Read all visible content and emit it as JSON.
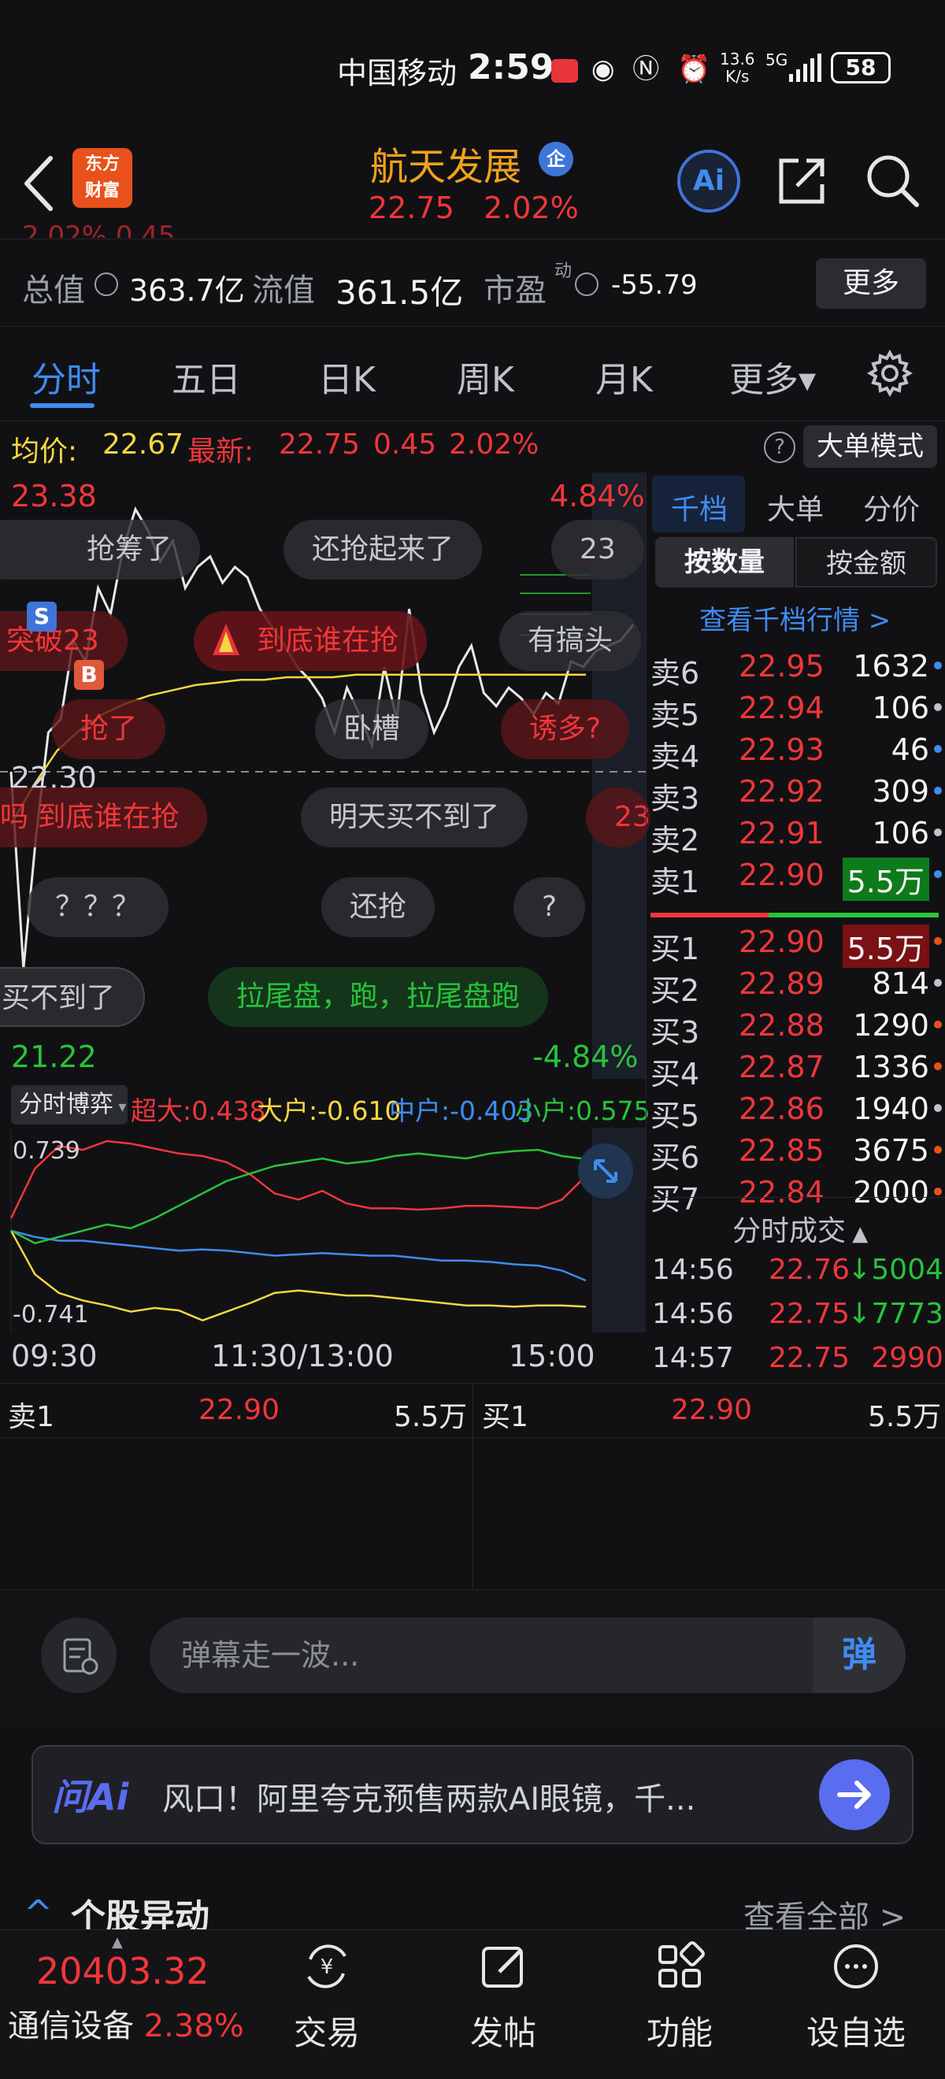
{
  "status_bar": {
    "carrier": "中国移动",
    "time": "2:59",
    "net_speed_top": "13.6",
    "net_speed_bottom": "K/s",
    "network": "5G",
    "battery": "58"
  },
  "header": {
    "logo_line1": "东方",
    "logo_line2": "财富",
    "stock_name": "航天发展",
    "ent_badge": "企",
    "price": "22.75",
    "change_pct": "2.02%",
    "ai_label": "Ai"
  },
  "metrics": {
    "cut_text": "2.02%    0.45",
    "total_value_label": "总值",
    "total_value": "363.7亿",
    "float_value_label": "流值",
    "float_value": "361.5亿",
    "pe_label": "市盈",
    "pe_sup": "动",
    "pe_value": "-55.79",
    "more_label": "更多"
  },
  "tabs": [
    "分时",
    "五日",
    "日K",
    "周K",
    "月K",
    "更多▾"
  ],
  "info_row": {
    "avg_label": "均价:",
    "avg_value": "22.67",
    "latest_label": "最新:",
    "latest_value": "22.75",
    "change": "0.45",
    "change_pct": "2.02%",
    "help": "?",
    "big_order_mode": "大单模式"
  },
  "chart_data": [
    {
      "type": "line",
      "title": "",
      "y_top_label": "23.38",
      "y_mid_label": "22.30",
      "y_bottom_label": "21.22",
      "pct_top_label": "4.84%",
      "pct_bottom_label": "-4.84%",
      "ylim": [
        21.22,
        23.38
      ],
      "x_labels": [
        "09:30",
        "11:30/13:00",
        "15:00"
      ],
      "series": [
        {
          "color": "#e8e8e8",
          "values": [
            22.3,
            21.55,
            22.05,
            22.45,
            22.5,
            22.8,
            22.72,
            23.0,
            22.9,
            23.15,
            23.3,
            23.22,
            23.1,
            23.18,
            23.0,
            23.08,
            23.12,
            23.02,
            23.08,
            23.04,
            22.92,
            22.85,
            22.78,
            22.7,
            22.65,
            22.58,
            22.45,
            22.62,
            22.52,
            22.4,
            22.7,
            22.5,
            22.92,
            22.6,
            22.45,
            22.55,
            22.7,
            22.78,
            22.6,
            22.55,
            22.62,
            22.58,
            22.52,
            22.6,
            22.56,
            22.72,
            22.7,
            22.76,
            22.78,
            22.8,
            22.86
          ]
        },
        {
          "color": "#f5d742",
          "values": [
            22.1,
            22.25,
            22.38,
            22.46,
            22.52,
            22.56,
            22.59,
            22.61,
            22.63,
            22.64,
            22.65,
            22.65,
            22.66,
            22.66,
            22.66,
            22.67,
            22.67,
            22.67,
            22.67,
            22.67,
            22.67,
            22.67,
            22.67,
            22.67,
            22.67,
            22.67
          ]
        }
      ]
    },
    {
      "type": "line",
      "title": "",
      "y_top_label": "0.739",
      "y_bottom_label": "-0.741",
      "ylim": [
        -0.741,
        0.739
      ],
      "series": [
        {
          "name": "超大",
          "color": "#f0363a",
          "values": [
            0.1,
            0.5,
            0.68,
            0.65,
            0.72,
            0.7,
            0.66,
            0.62,
            0.6,
            0.55,
            0.45,
            0.3,
            0.25,
            0.32,
            0.22,
            0.18,
            0.18,
            0.17,
            0.18,
            0.2,
            0.2,
            0.19,
            0.18,
            0.25,
            0.44
          ]
        },
        {
          "name": "大户",
          "color": "#f5d742",
          "values": [
            0.0,
            -0.35,
            -0.5,
            -0.56,
            -0.6,
            -0.65,
            -0.62,
            -0.64,
            -0.72,
            -0.65,
            -0.58,
            -0.5,
            -0.48,
            -0.5,
            -0.52,
            -0.52,
            -0.54,
            -0.56,
            -0.58,
            -0.6,
            -0.6,
            -0.61,
            -0.6,
            -0.6,
            -0.61
          ]
        },
        {
          "name": "中户",
          "color": "#3f8cf0",
          "values": [
            0.0,
            -0.05,
            -0.08,
            -0.08,
            -0.1,
            -0.12,
            -0.14,
            -0.16,
            -0.15,
            -0.16,
            -0.18,
            -0.2,
            -0.19,
            -0.18,
            -0.19,
            -0.2,
            -0.2,
            -0.22,
            -0.24,
            -0.24,
            -0.25,
            -0.27,
            -0.28,
            -0.32,
            -0.4
          ]
        },
        {
          "name": "小户",
          "color": "#27c43a",
          "values": [
            0.0,
            -0.1,
            -0.05,
            0.0,
            0.05,
            0.02,
            0.1,
            0.2,
            0.3,
            0.4,
            0.46,
            0.52,
            0.55,
            0.58,
            0.54,
            0.56,
            0.6,
            0.62,
            0.6,
            0.58,
            0.62,
            0.64,
            0.65,
            0.6,
            0.575
          ]
        }
      ]
    }
  ],
  "danmaku": [
    {
      "text": "抢筹了",
      "style": "dark"
    },
    {
      "text": "还抢起来了",
      "style": "dark"
    },
    {
      "text": "23",
      "style": "dark"
    },
    {
      "text": "突破23",
      "style": "redb"
    },
    {
      "text": "到底谁在抢",
      "style": "redhi"
    },
    {
      "text": "有搞头",
      "style": "dark"
    },
    {
      "text": "抢了",
      "style": "redb"
    },
    {
      "text": "卧槽",
      "style": "dark"
    },
    {
      "text": "诱多?",
      "style": "redb"
    },
    {
      "text": "吗 到底谁在抢",
      "style": "redb"
    },
    {
      "text": "明天买不到了",
      "style": "dark"
    },
    {
      "text": "23",
      "style": "redb"
    },
    {
      "text": "？？？",
      "style": "dark"
    },
    {
      "text": "还抢",
      "style": "dark"
    },
    {
      "text": "?",
      "style": "dark"
    },
    {
      "text": "买不到了",
      "style": "dark"
    },
    {
      "text": "拉尾盘，跑，拉尾盘跑",
      "style": "greenb"
    }
  ],
  "markers": {
    "s": "S",
    "b": "B"
  },
  "order_book": {
    "tabs": [
      "千档",
      "大单",
      "分价"
    ],
    "toggle_qty": "按数量",
    "toggle_amt": "按金额",
    "link": "查看千档行情 >",
    "asks": [
      {
        "label": "卖6",
        "price": "22.95",
        "vol": "1632"
      },
      {
        "label": "卖5",
        "price": "22.94",
        "vol": "106"
      },
      {
        "label": "卖4",
        "price": "22.93",
        "vol": "46"
      },
      {
        "label": "卖3",
        "price": "22.92",
        "vol": "309"
      },
      {
        "label": "卖2",
        "price": "22.91",
        "vol": "106"
      },
      {
        "label": "卖1",
        "price": "22.90",
        "vol": "5.5万"
      }
    ],
    "bids": [
      {
        "label": "买1",
        "price": "22.90",
        "vol": "5.5万"
      },
      {
        "label": "买2",
        "price": "22.89",
        "vol": "814"
      },
      {
        "label": "买3",
        "price": "22.88",
        "vol": "1290"
      },
      {
        "label": "买4",
        "price": "22.87",
        "vol": "1336"
      },
      {
        "label": "买5",
        "price": "22.86",
        "vol": "1940"
      },
      {
        "label": "买6",
        "price": "22.85",
        "vol": "3675"
      },
      {
        "label": "买7",
        "price": "22.84",
        "vol": "2000"
      }
    ],
    "trades_title": "分时成交",
    "trades": [
      {
        "time": "14:56",
        "price": "22.76",
        "vol": "↓5004",
        "dir": "down"
      },
      {
        "time": "14:56",
        "price": "22.75",
        "vol": "↓7773",
        "dir": "down"
      },
      {
        "time": "14:57",
        "price": "22.75",
        "vol": "2990",
        "dir": "up"
      }
    ]
  },
  "game": {
    "select_label": "分时博弈",
    "legend": [
      {
        "name": "超大",
        "value": ":0.438"
      },
      {
        "name": "大户",
        "value": ":-0.610"
      },
      {
        "name": "中户",
        "value": ":-0.403"
      },
      {
        "name": "小户",
        "value": ":0.575"
      }
    ]
  },
  "level1": {
    "ask_label": "卖1",
    "ask_price": "22.90",
    "ask_vol": "5.5万",
    "bid_label": "买1",
    "bid_price": "22.90",
    "bid_vol": "5.5万"
  },
  "comment": {
    "placeholder": "弹幕走一波...",
    "danmaku_button": "弹"
  },
  "ask_ai": {
    "logo": "问Ai",
    "text": "风口！阿里夸克预售两款AI眼镜，千..."
  },
  "news": {
    "title": "个股异动",
    "view_all": "查看全部 >"
  },
  "bottom_nav": {
    "index_value": "20403.32",
    "index_name": "通信设备",
    "index_pct": "2.38%",
    "items": [
      "交易",
      "发帖",
      "功能",
      "设自选"
    ]
  },
  "colors": {
    "up": "#f0363a",
    "down": "#27c43a",
    "accent": "#3f8cf0",
    "brand": "#e8511b"
  }
}
